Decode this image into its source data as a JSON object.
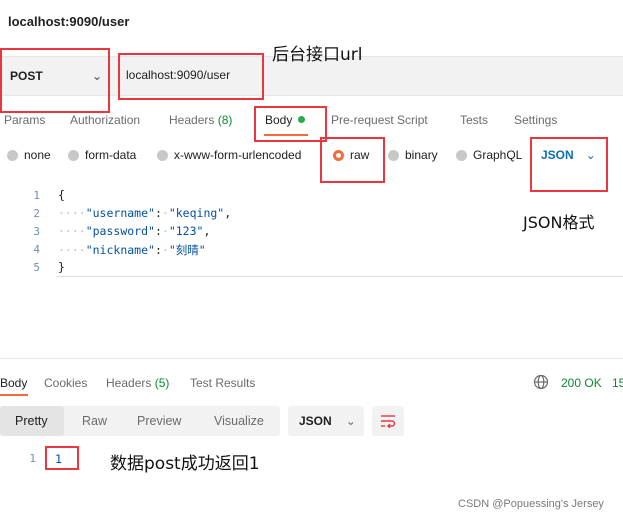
{
  "window": {
    "title": "localhost:9090/user"
  },
  "request": {
    "method": "POST",
    "url": "localhost:9090/user"
  },
  "annotations": {
    "backend_url": "后台接口url",
    "json_format": "JSON格式",
    "post_result": "数据post成功返回1"
  },
  "request_tabs": [
    {
      "label": "Params"
    },
    {
      "label": "Authorization"
    },
    {
      "label": "Headers",
      "count": "(8)"
    },
    {
      "label": "Body"
    },
    {
      "label": "Pre-request Script"
    },
    {
      "label": "Tests"
    },
    {
      "label": "Settings"
    }
  ],
  "body_types": [
    {
      "label": "none",
      "selected": false
    },
    {
      "label": "form-data",
      "selected": false
    },
    {
      "label": "x-www-form-urlencoded",
      "selected": false
    },
    {
      "label": "raw",
      "selected": true
    },
    {
      "label": "binary",
      "selected": false
    },
    {
      "label": "GraphQL",
      "selected": false
    }
  ],
  "body_format": "JSON",
  "editor": {
    "line_numbers": [
      "1",
      "2",
      "3",
      "4",
      "5"
    ],
    "open_brace": "{",
    "close_brace": "}",
    "fields": [
      {
        "key": "\"username\"",
        "value": "\"keqing\"",
        "comma": ","
      },
      {
        "key": "\"password\"",
        "value": "\"123\"",
        "comma": ","
      },
      {
        "key": "\"nickname\"",
        "value": "\"刻晴\"",
        "comma": ""
      }
    ]
  },
  "response_tabs": [
    {
      "label": "Body"
    },
    {
      "label": "Cookies"
    },
    {
      "label": "Headers",
      "count": "(5)"
    },
    {
      "label": "Test Results"
    }
  ],
  "response_status": {
    "code": "200 OK",
    "time_partial": "15"
  },
  "view_modes": [
    "Pretty",
    "Raw",
    "Preview",
    "Visualize"
  ],
  "response_format": "JSON",
  "response": {
    "line_number": "1",
    "value": "1"
  },
  "watermark": "CSDN @Popuessing's Jersey",
  "colors": {
    "accent": "#f26b3a",
    "highlight_box": "#e8373e",
    "success": "#0a8a35",
    "link": "#0b6fb3"
  }
}
